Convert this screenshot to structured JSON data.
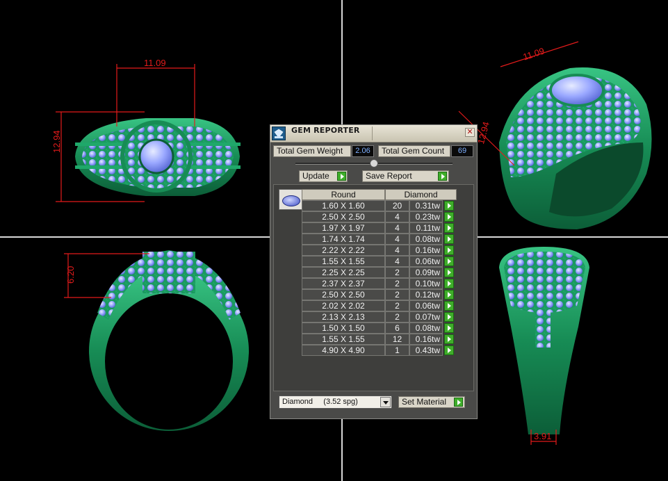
{
  "viewports": {
    "dimensions": {
      "top_width": "11.09",
      "top_height": "12.94",
      "iso_width": "11.09",
      "iso_height": "12.94",
      "front_height": "6.20",
      "side_width": "3.91"
    },
    "colors": {
      "metal": "#1fa86a",
      "gem": "#9aa8ff",
      "dimension": "#e41b1b",
      "background": "#000000"
    }
  },
  "panel": {
    "title": "GEM REPORTER",
    "close_label": "✕",
    "total_weight_label": "Total Gem Weight",
    "total_weight_value": "2.06",
    "total_count_label": "Total Gem Count",
    "total_count_value": "69",
    "update_label": "Update",
    "save_report_label": "Save Report",
    "shape_header": "Round",
    "material_header": "Diamond",
    "rows": [
      {
        "size": "1.60 X 1.60",
        "count": "20",
        "weight": "0.31tw"
      },
      {
        "size": "2.50 X 2.50",
        "count": "4",
        "weight": "0.23tw"
      },
      {
        "size": "1.97 X 1.97",
        "count": "4",
        "weight": "0.11tw"
      },
      {
        "size": "1.74 X 1.74",
        "count": "4",
        "weight": "0.08tw"
      },
      {
        "size": "2.22 X 2.22",
        "count": "4",
        "weight": "0.16tw"
      },
      {
        "size": "1.55 X 1.55",
        "count": "4",
        "weight": "0.06tw"
      },
      {
        "size": "2.25 X 2.25",
        "count": "2",
        "weight": "0.09tw"
      },
      {
        "size": "2.37 X 2.37",
        "count": "2",
        "weight": "0.10tw"
      },
      {
        "size": "2.50 X 2.50",
        "count": "2",
        "weight": "0.12tw"
      },
      {
        "size": "2.02 X 2.02",
        "count": "2",
        "weight": "0.06tw"
      },
      {
        "size": "2.13 X 2.13",
        "count": "2",
        "weight": "0.07tw"
      },
      {
        "size": "1.50 X 1.50",
        "count": "6",
        "weight": "0.08tw"
      },
      {
        "size": "1.55 X 1.55",
        "count": "12",
        "weight": "0.16tw"
      },
      {
        "size": "4.90 X 4.90",
        "count": "1",
        "weight": "0.43tw"
      }
    ],
    "material_select_value": "Diamond     (3.52 spg)",
    "set_material_label": "Set Material",
    "icons": {
      "title": "gem-reporter-icon",
      "shape": "round-gem-icon",
      "arrow": "play-arrow-icon"
    }
  }
}
